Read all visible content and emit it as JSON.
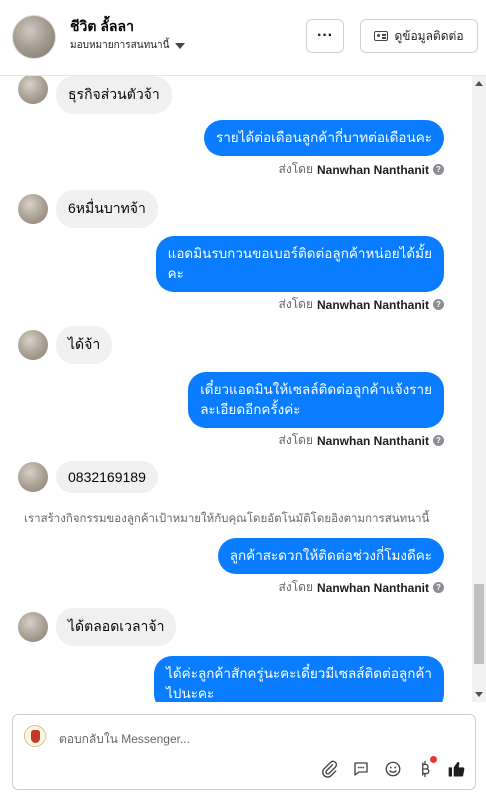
{
  "header": {
    "contact_name": "ชีวิต ลั้ลลา",
    "assign_label": "มอบหมายการสนทนานี้",
    "more_label": "···",
    "contact_info_label": "ดูข้อมูลติดต่อ"
  },
  "messages": [
    {
      "type": "in",
      "text": "ธุรกิจส่วนตัวจ้า"
    },
    {
      "type": "out",
      "lines": [
        "รายได้ต่อเดือนลูกค้ากี่บาทต่อเดือนคะ"
      ]
    },
    {
      "type": "sent_by",
      "prefix": "ส่งโดย",
      "name": "Nanwhan Nanthanit"
    },
    {
      "type": "in",
      "text": "6หมื่นบาทจ้า"
    },
    {
      "type": "out",
      "lines": [
        "แอดมินรบกวนขอเบอร์ติดต่อลูกค้าหน่อยได้มั้ย",
        "คะ"
      ]
    },
    {
      "type": "sent_by",
      "prefix": "ส่งโดย",
      "name": "Nanwhan Nanthanit"
    },
    {
      "type": "in",
      "text": "ได้จ้า"
    },
    {
      "type": "out",
      "lines": [
        "เดี๋ยวแอดมินให้เซลล์ติดต่อลูกค้าแจ้งราย",
        "ละเอียดอีกครั้งค่ะ"
      ]
    },
    {
      "type": "sent_by",
      "prefix": "ส่งโดย",
      "name": "Nanwhan Nanthanit"
    },
    {
      "type": "in",
      "text": "0832169189"
    },
    {
      "type": "system",
      "text": "เราสร้างกิจกรรมของลูกค้าเป้าหมายให้กับคุณโดยอัตโนมัติโดยอิงตามการสนทนานี้"
    },
    {
      "type": "out",
      "lines": [
        "ลูกค้าสะดวกให้ติดต่อช่วงกี่โมงดีคะ"
      ]
    },
    {
      "type": "sent_by",
      "prefix": "ส่งโดย",
      "name": "Nanwhan Nanthanit"
    },
    {
      "type": "in",
      "text": "ได้ตลอดเวลาจ้า"
    },
    {
      "type": "out",
      "lines": [
        "ได้ค่ะลูกค้าสักครู่นะคะเดี๋ยวมีเซลส์ติดต่อลูกค้า",
        "ไปนะคะ"
      ]
    }
  ],
  "composer": {
    "placeholder": "ตอบกลับใน Messenger..."
  },
  "icons": [
    "attachment-icon",
    "saved-replies-icon",
    "emoji-icon",
    "payment-icon",
    "like-icon"
  ],
  "colors": {
    "outgoing_bubble": "#0a7cff",
    "incoming_bubble": "#f0f0f0",
    "like_icon": "#1c1e21"
  }
}
